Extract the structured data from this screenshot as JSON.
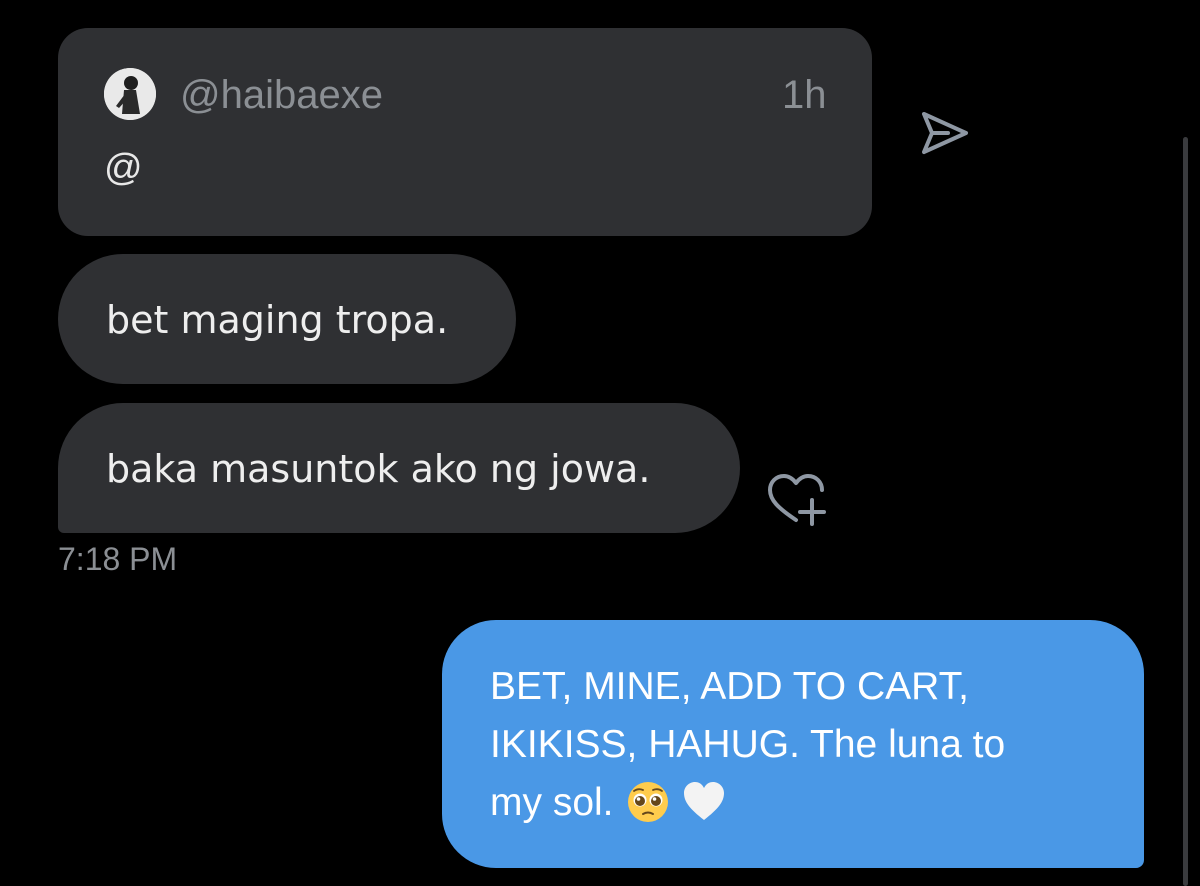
{
  "quoted_message": {
    "handle": "@haibaexe",
    "time": "1h",
    "text": "@"
  },
  "received_messages": [
    {
      "text": "bet maging tropa."
    },
    {
      "text": "baka masuntok ako ng jowa."
    }
  ],
  "received_timestamp": "7:18 PM",
  "sent_message": {
    "lines": [
      "BET, MINE, ADD TO CART,",
      "IKIKISS, HAHUG. The luna to",
      "my sol."
    ],
    "emojis": [
      "pleading-face-emoji",
      "white-heart-emoji"
    ]
  },
  "colors": {
    "background": "#000000",
    "received_bubble": "#2f3033",
    "sent_bubble": "#4a98e6",
    "muted_text": "#8b8f94"
  },
  "icons": [
    "avatar",
    "send-icon",
    "add-reaction-icon"
  ]
}
